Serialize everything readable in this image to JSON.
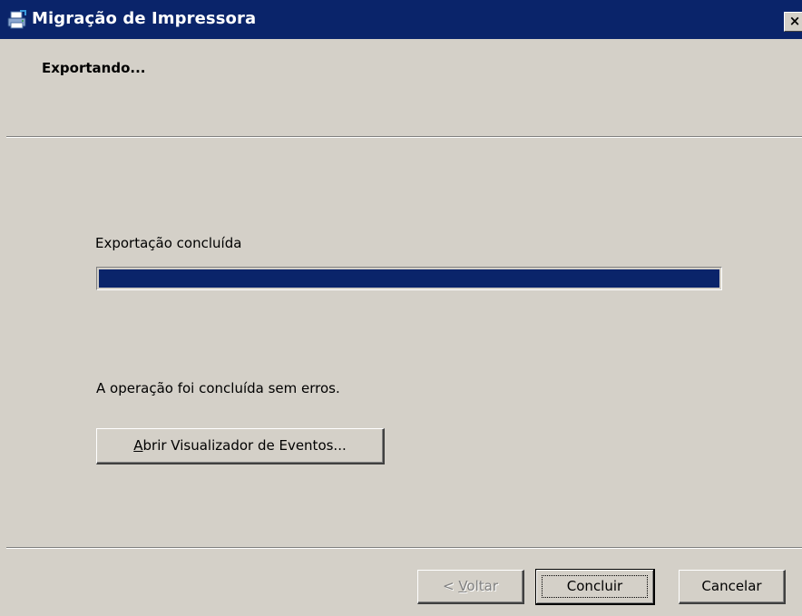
{
  "window": {
    "title": "Migração de Impressora",
    "close_glyph": "×",
    "icon": "printer-migration-icon"
  },
  "header": {
    "title": "Exportando..."
  },
  "progress": {
    "label": "Exportação concluída",
    "fraction": 1.0,
    "color": "#0a246a"
  },
  "result": {
    "message": "A operação foi concluída sem erros."
  },
  "buttons": {
    "events": {
      "accel": "A",
      "rest": "brir Visualizador de Eventos..."
    },
    "back": {
      "prefix": "< ",
      "accel": "V",
      "rest": "oltar",
      "enabled": false
    },
    "finish": {
      "label": "Concluir"
    },
    "cancel": {
      "label": "Cancelar"
    }
  },
  "colors": {
    "titlebar": "#0a246a",
    "dialog_bg": "#d4d0c8",
    "disabled_text": "#808080"
  }
}
